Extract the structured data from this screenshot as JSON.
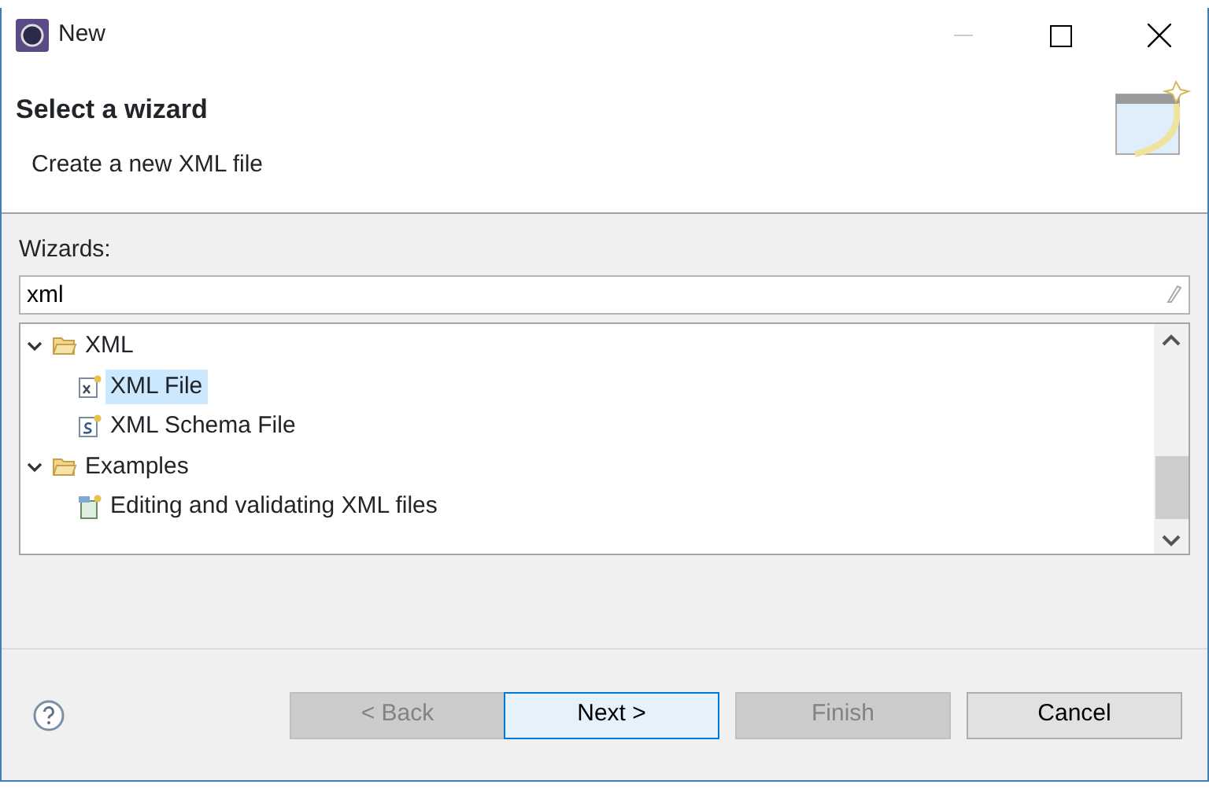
{
  "window": {
    "title": "New"
  },
  "header": {
    "title": "Select a wizard",
    "description": "Create a new XML file"
  },
  "wizards": {
    "label": "Wizards:",
    "filter": {
      "value": "xml"
    },
    "tree": [
      {
        "label": "XML",
        "kind": "folder",
        "expanded": true,
        "selected": false,
        "children": [
          {
            "label": "XML File",
            "kind": "xml-file",
            "selected": true
          },
          {
            "label": "XML Schema File",
            "kind": "schema-file",
            "selected": false
          }
        ]
      },
      {
        "label": "Examples",
        "kind": "folder",
        "expanded": true,
        "selected": false,
        "children": [
          {
            "label": "Editing and validating XML files",
            "kind": "example",
            "selected": false
          }
        ]
      }
    ]
  },
  "buttons": [
    {
      "label": "< Back",
      "disabled": true,
      "default": false
    },
    {
      "label": "Next >",
      "disabled": false,
      "default": true
    },
    {
      "label": "Finish",
      "disabled": true,
      "default": false
    },
    {
      "label": "Cancel",
      "disabled": false,
      "default": false
    }
  ]
}
